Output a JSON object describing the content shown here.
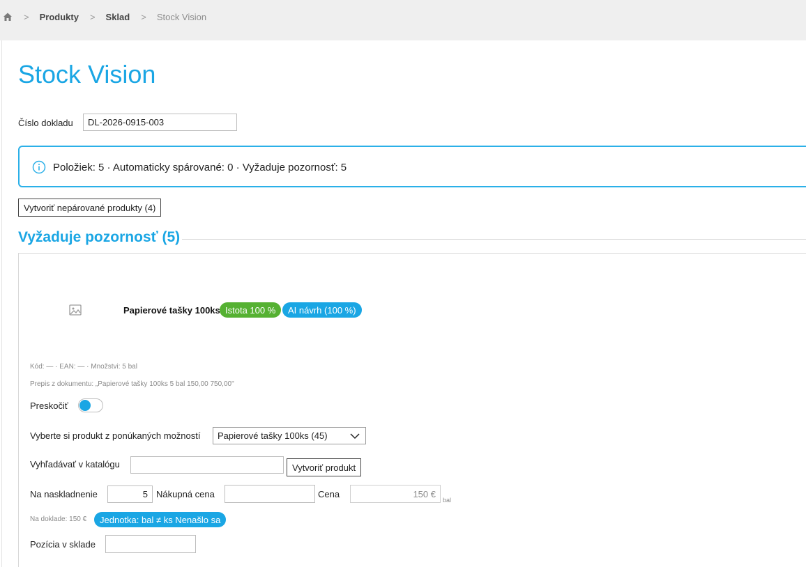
{
  "breadcrumb": {
    "items": [
      "Produkty",
      "Sklad"
    ],
    "current": "Stock Vision"
  },
  "page": {
    "title": "Stock Vision"
  },
  "document": {
    "label": "Číslo dokladu",
    "value": "DL-2026-0915-003"
  },
  "info": {
    "text": "Položiek: 5 · Automaticky spárované: 0 · Vyžaduje pozornosť: 5"
  },
  "actions": {
    "create_unpaired": "Vytvoriť nepárované produkty (4)"
  },
  "section": {
    "title": "Vyžaduje pozornosť (5)"
  },
  "item": {
    "name": "Papierové tašky 100ks",
    "badge_confidence": "Istota 100 %",
    "badge_ai": "AI návrh (100 %)",
    "meta_code": "Kód: — · EAN: — · Množstvi: 5 bal",
    "meta_ocr": "Prepis z dokumentu: „Papierové tašky 100ks 5 bal 150,00 750,00\"",
    "skip_label": "Preskočiť",
    "skip_on": true,
    "select_label": "Vyberte si produkt z ponúkaných možností",
    "select_value": "Papierové tašky 100ks (45)",
    "search_label": "Vyhľadávať v katalógu",
    "search_value": "",
    "create_product": "Vytvoriť produkt",
    "qty_label": "Na naskladnenie",
    "qty_value": "5",
    "purchase_label": "Nákupná cena",
    "purchase_value": "",
    "price_label": "Cena",
    "price_value": "150 €",
    "price_unit": "bal",
    "on_doc": "Na doklade: 150 €",
    "unit_badge": "Jednotka: bal ≠ ks Nenašlo sa",
    "position_label": "Pozícia v sklade",
    "position_value": ""
  },
  "colors": {
    "accent": "#1aa6e4",
    "success": "#55b132"
  }
}
